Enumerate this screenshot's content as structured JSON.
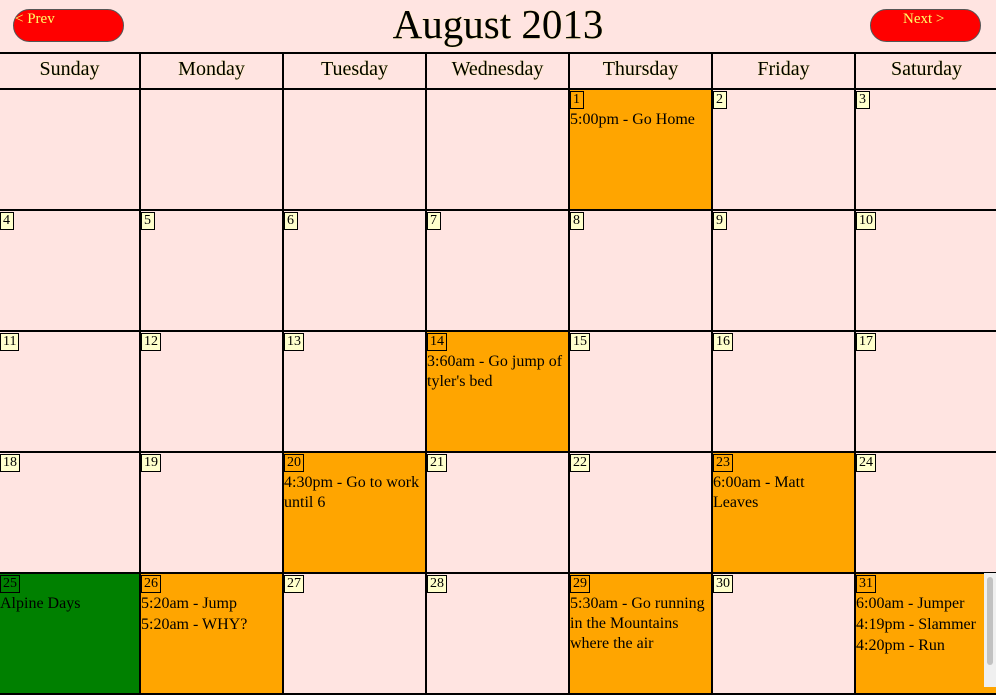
{
  "nav": {
    "prev": "< Prev",
    "next": "Next >"
  },
  "title": "August 2013",
  "weekdays": [
    "Sunday",
    "Monday",
    "Tuesday",
    "Wednesday",
    "Thursday",
    "Friday",
    "Saturday"
  ],
  "colors": {
    "background": "#ffe4e1",
    "event": "#ffa500",
    "special": "#008000",
    "button": "#ff0000",
    "button_text": "#ffff66"
  },
  "cells": [
    {
      "day": "",
      "events": [],
      "style": "empty"
    },
    {
      "day": "",
      "events": [],
      "style": "empty"
    },
    {
      "day": "",
      "events": [],
      "style": "empty"
    },
    {
      "day": "",
      "events": [],
      "style": "empty"
    },
    {
      "day": "1",
      "events": [
        "5:00pm - Go Home"
      ],
      "style": "event"
    },
    {
      "day": "2",
      "events": [],
      "style": "normal"
    },
    {
      "day": "3",
      "events": [],
      "style": "normal"
    },
    {
      "day": "4",
      "events": [],
      "style": "normal"
    },
    {
      "day": "5",
      "events": [],
      "style": "normal"
    },
    {
      "day": "6",
      "events": [],
      "style": "normal"
    },
    {
      "day": "7",
      "events": [],
      "style": "normal"
    },
    {
      "day": "8",
      "events": [],
      "style": "normal"
    },
    {
      "day": "9",
      "events": [],
      "style": "normal"
    },
    {
      "day": "10",
      "events": [],
      "style": "normal"
    },
    {
      "day": "11",
      "events": [],
      "style": "normal"
    },
    {
      "day": "12",
      "events": [],
      "style": "normal"
    },
    {
      "day": "13",
      "events": [],
      "style": "normal"
    },
    {
      "day": "14",
      "events": [
        "3:60am - Go jump of tyler's bed"
      ],
      "style": "event"
    },
    {
      "day": "15",
      "events": [],
      "style": "normal"
    },
    {
      "day": "16",
      "events": [],
      "style": "normal"
    },
    {
      "day": "17",
      "events": [],
      "style": "normal"
    },
    {
      "day": "18",
      "events": [],
      "style": "normal"
    },
    {
      "day": "19",
      "events": [],
      "style": "normal"
    },
    {
      "day": "20",
      "events": [
        "4:30pm - Go to work until 6"
      ],
      "style": "event"
    },
    {
      "day": "21",
      "events": [],
      "style": "normal"
    },
    {
      "day": "22",
      "events": [],
      "style": "normal"
    },
    {
      "day": "23",
      "events": [
        "6:00am - Matt Leaves"
      ],
      "style": "event"
    },
    {
      "day": "24",
      "events": [],
      "style": "normal"
    },
    {
      "day": "25",
      "events": [
        "Alpine Days"
      ],
      "style": "green"
    },
    {
      "day": "26",
      "events": [
        "5:20am - Jump",
        "5:20am - WHY?"
      ],
      "style": "event"
    },
    {
      "day": "27",
      "events": [],
      "style": "normal"
    },
    {
      "day": "28",
      "events": [],
      "style": "normal"
    },
    {
      "day": "29",
      "events": [
        "5:30am - Go running in the Mountains where the air"
      ],
      "style": "event"
    },
    {
      "day": "30",
      "events": [],
      "style": "normal"
    },
    {
      "day": "31",
      "events": [
        "6:00am - Jumper",
        "4:19pm - Slammer",
        "4:20pm - Run"
      ],
      "style": "event"
    }
  ]
}
